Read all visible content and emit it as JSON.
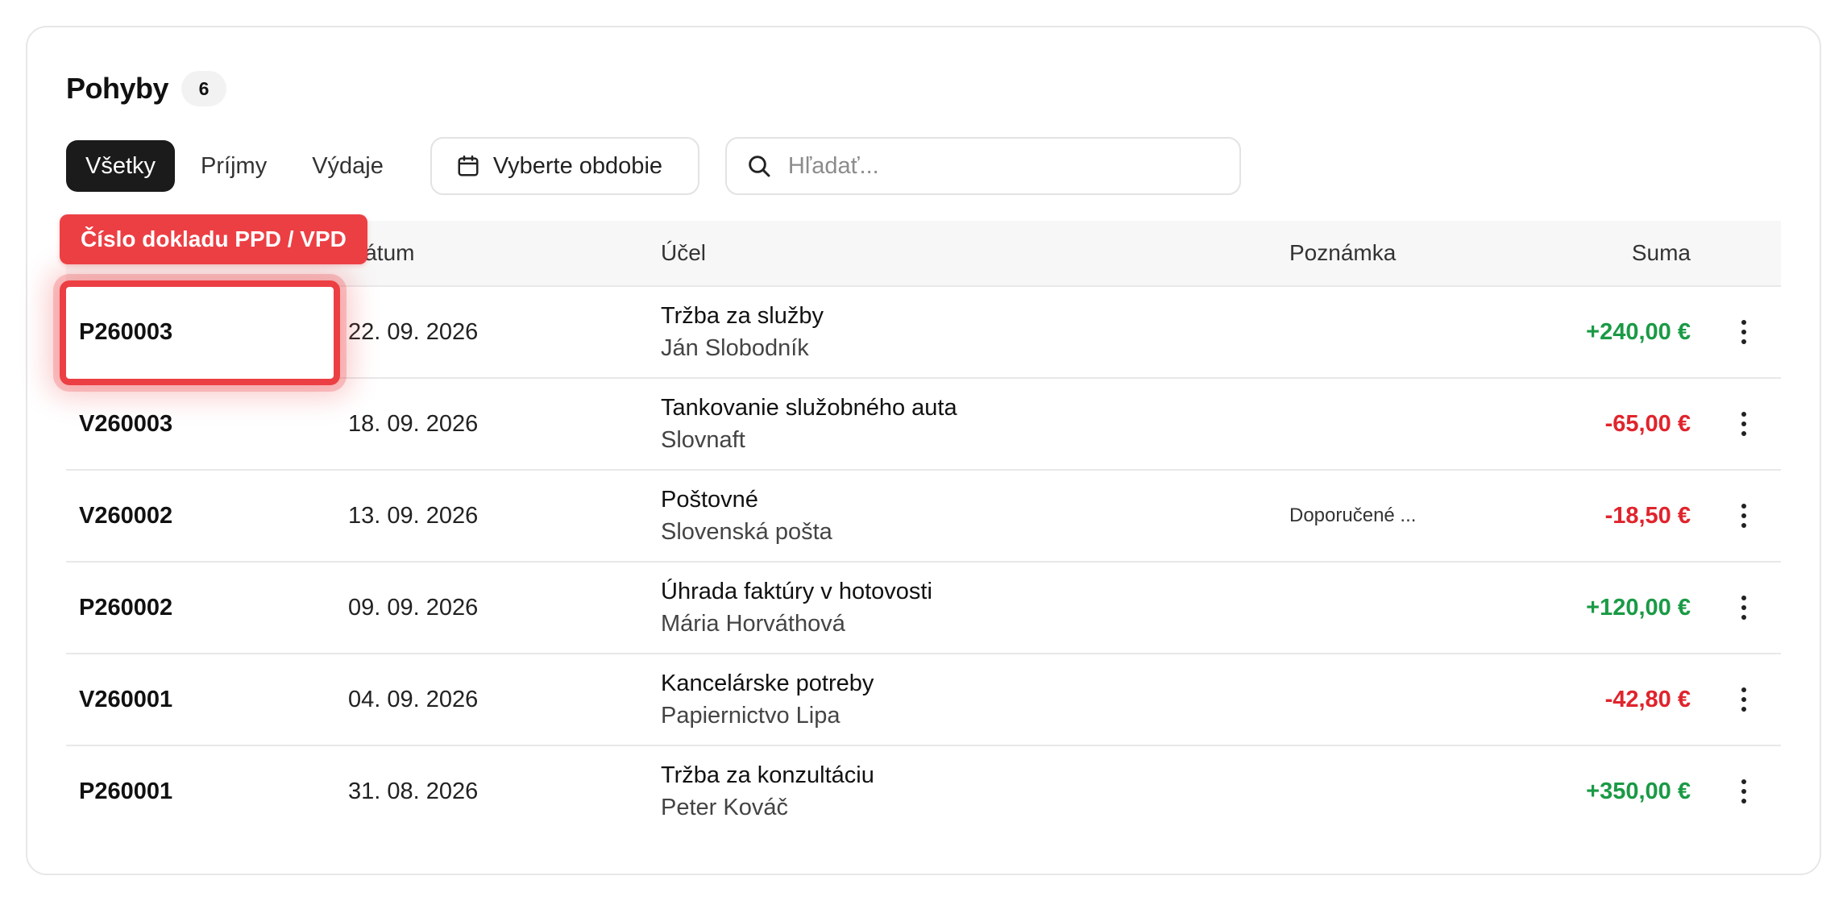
{
  "header": {
    "title": "Pohyby",
    "count": "6"
  },
  "tabs": [
    {
      "label": "Všetky",
      "active": true
    },
    {
      "label": "Príjmy",
      "active": false
    },
    {
      "label": "Výdaje",
      "active": false
    }
  ],
  "date_picker": {
    "label": "Vyberte obdobie",
    "icon": "calendar-icon"
  },
  "search": {
    "placeholder": "Hľadať...",
    "value": "",
    "icon": "search-icon"
  },
  "table": {
    "columns": {
      "date": "Dátum",
      "purpose": "Účel",
      "note": "Poznámka",
      "sum": "Suma"
    },
    "rows": [
      {
        "doc": "P260003",
        "date": "22. 09. 2026",
        "purpose": "Tržba za služby",
        "party": "Ján Slobodník",
        "note": "",
        "sum": "+240,00 €",
        "type": "income"
      },
      {
        "doc": "V260003",
        "date": "18. 09. 2026",
        "purpose": "Tankovanie služobného auta",
        "party": "Slovnaft",
        "note": "",
        "sum": "-65,00 €",
        "type": "expense"
      },
      {
        "doc": "V260002",
        "date": "13. 09. 2026",
        "purpose": "Poštovné",
        "party": "Slovenská pošta",
        "note": "Doporučené ...",
        "sum": "-18,50 €",
        "type": "expense"
      },
      {
        "doc": "P260002",
        "date": "09. 09. 2026",
        "purpose": "Úhrada faktúry v hotovosti",
        "party": "Mária Horváthová",
        "note": "",
        "sum": "+120,00 €",
        "type": "income"
      },
      {
        "doc": "V260001",
        "date": "04. 09. 2026",
        "purpose": "Kancelárske potreby",
        "party": "Papiernictvo Lipa",
        "note": "",
        "sum": "-42,80 €",
        "type": "expense"
      },
      {
        "doc": "P260001",
        "date": "31. 08. 2026",
        "purpose": "Tržba za konzultáciu",
        "party": "Peter Kováč",
        "note": "",
        "sum": "+350,00 €",
        "type": "income"
      }
    ]
  },
  "tooltip": {
    "label": "Číslo dokladu PPD / VPD"
  },
  "colors": {
    "accent": "#ec3f44",
    "income": "#1a9a45",
    "expense": "#e0242c",
    "tab_active_bg": "#1b1b1b"
  }
}
